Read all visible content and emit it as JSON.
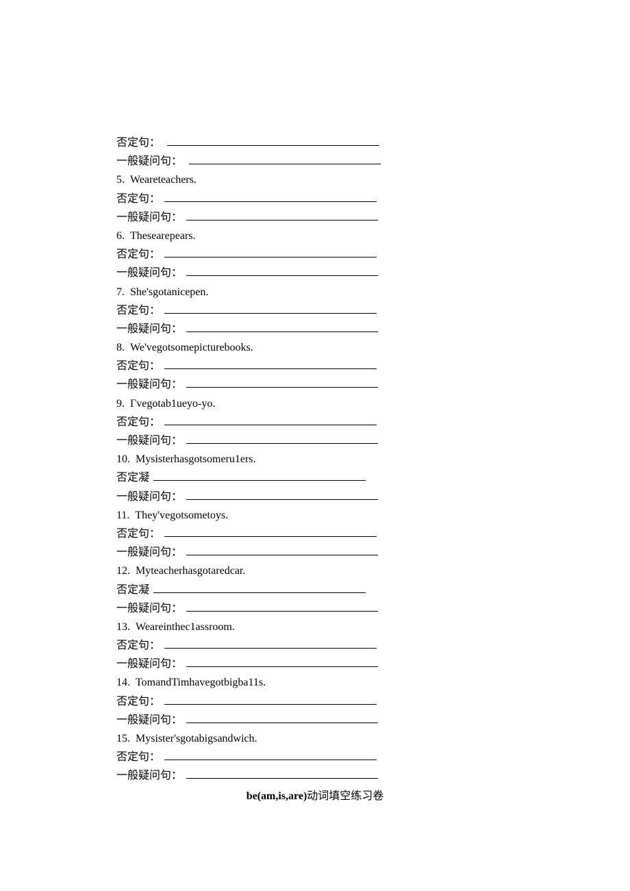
{
  "labels": {
    "neg": "否定句：",
    "neg_alt": "否定凝",
    "gen": "一般疑问句："
  },
  "items": [
    {
      "num": "5.",
      "text": "Weareteachers.",
      "neg_alt": false
    },
    {
      "num": "6.",
      "text": "Thesearepears.",
      "neg_alt": false
    },
    {
      "num": "7.",
      "text": "She'sgotanicepen.",
      "neg_alt": false
    },
    {
      "num": "8.",
      "text": "We'vegotsomepicturebooks.",
      "neg_alt": false
    },
    {
      "num": "9.",
      "text": "Γvegotab1ueyo-yo.",
      "neg_alt": false
    },
    {
      "num": "10.",
      "text": "Mysisterhasgotsomeru1ers.",
      "neg_alt": true
    },
    {
      "num": "11.",
      "text": "They'vegotsometoys.",
      "neg_alt": false
    },
    {
      "num": "12.",
      "text": "Myteacherhasgotaredcar.",
      "neg_alt": true
    },
    {
      "num": "13.",
      "text": "Weareinthec1assroom.",
      "neg_alt": false
    },
    {
      "num": "14.",
      "text": "TomandTimhavegotbigba11s.",
      "neg_alt": false
    },
    {
      "num": "15.",
      "text": "Mysister'sgotabigsandwich.",
      "neg_alt": false
    }
  ],
  "title_bold": "be(am,is,are)",
  "title_rest": "动词填空练习卷",
  "blank_widths": {
    "neg": "310px",
    "gen": "280px"
  }
}
